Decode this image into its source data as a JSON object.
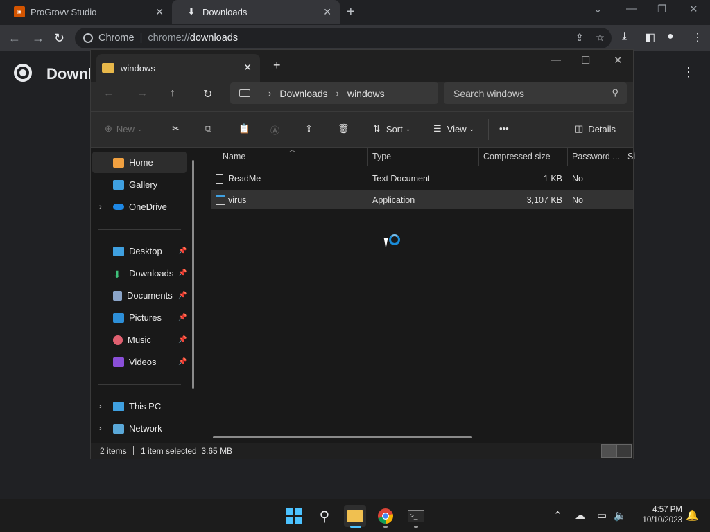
{
  "chrome": {
    "tabs": [
      {
        "title": "ProGrovv Studio",
        "favicon": "progrovv-icon"
      },
      {
        "title": "Downloads",
        "favicon": "download-icon"
      }
    ],
    "omnibox": {
      "label": "Chrome",
      "scheme": "chrome://",
      "host": "downloads"
    },
    "page_title": "Downl"
  },
  "explorer": {
    "tab_title": "windows",
    "breadcrumb": [
      "Downloads",
      "windows"
    ],
    "search_placeholder": "Search windows",
    "commands": {
      "new": "New",
      "sort": "Sort",
      "view": "View",
      "details": "Details",
      "more": "•••"
    },
    "nav": {
      "home": "Home",
      "gallery": "Gallery",
      "onedrive": "OneDrive",
      "desktop": "Desktop",
      "downloads": "Downloads",
      "documents": "Documents",
      "pictures": "Pictures",
      "music": "Music",
      "videos": "Videos",
      "thispc": "This PC",
      "network": "Network"
    },
    "columns": {
      "name": "Name",
      "type": "Type",
      "size": "Compressed size",
      "password": "Password ...",
      "extra": "Si"
    },
    "files": [
      {
        "name": "ReadMe",
        "type": "Text Document",
        "size": "1 KB",
        "password": "No"
      },
      {
        "name": "virus",
        "type": "Application",
        "size": "3,107 KB",
        "password": "No"
      }
    ],
    "status": {
      "items": "2 items",
      "selected": "1 item selected  3.65 MB"
    }
  },
  "taskbar": {
    "time": "4:57 PM",
    "date": "10/10/2023"
  },
  "colors": {
    "accent": "#1a8cd8",
    "folder": "#e8b84a"
  }
}
